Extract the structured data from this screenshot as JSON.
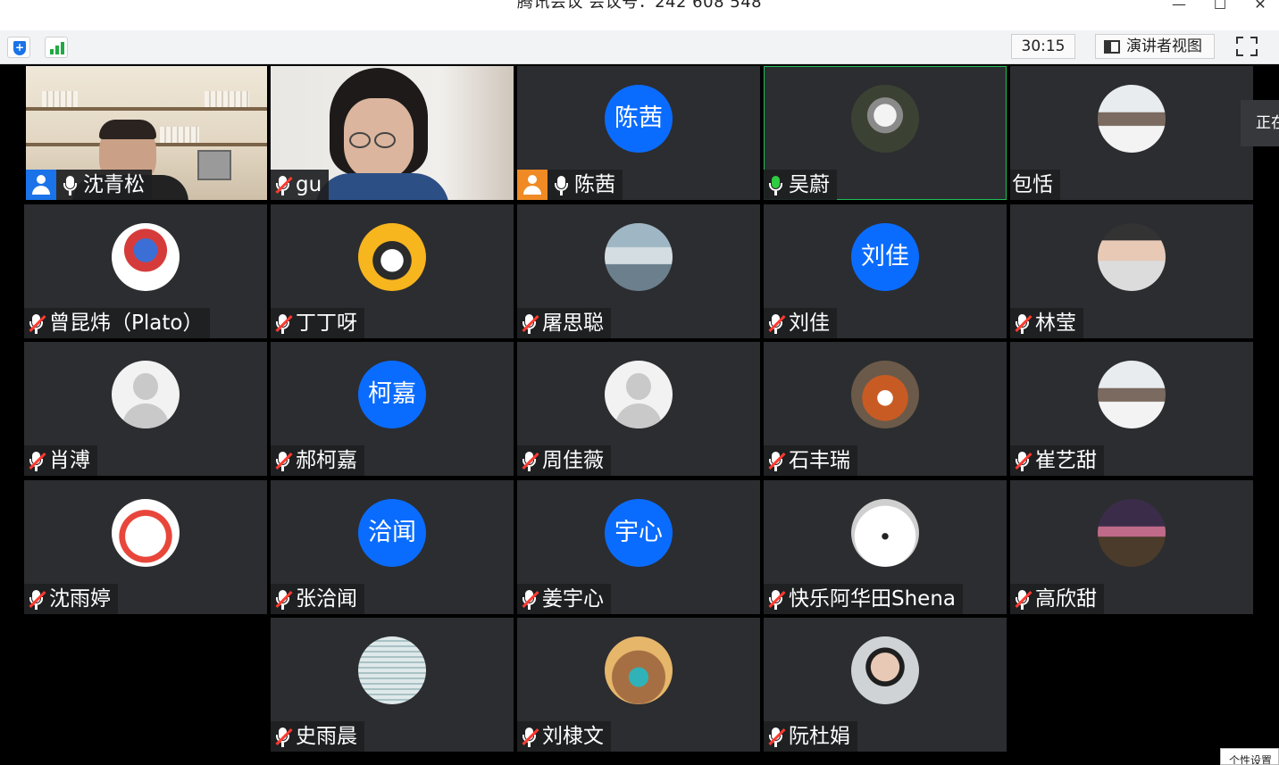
{
  "window": {
    "title": "腾讯会议 会议号：242 608 548",
    "min_glyph": "—",
    "max_glyph": "☐",
    "close_glyph": "✕"
  },
  "toolbar": {
    "security_icon": "shield-icon",
    "signal_icon": "network-signal-icon",
    "timer": "30:15",
    "presenter_view_label": "演讲者视图",
    "fullscreen_icon": "fullscreen-icon"
  },
  "side_tab": {
    "label": "正在"
  },
  "corner_popup": {
    "label": "个性设置"
  },
  "colors": {
    "avatar_blue": "#0a6cff",
    "speaking_green": "#1fbf58",
    "muted_red": "#ff3b30",
    "tile_bg": "#2c2d30"
  },
  "participants": [
    {
      "name": "沈青松",
      "video": true,
      "host_icon": "blue",
      "mic": "on"
    },
    {
      "name": "gu",
      "video": true,
      "mic": "muted"
    },
    {
      "name": "陈茜",
      "avatar_text": "陈茜",
      "host_icon": "orange",
      "mic": "on"
    },
    {
      "name": "吴蔚",
      "avatar_icon": "cat-photo",
      "mic": "speaking"
    },
    {
      "name": "包恬",
      "avatar_icon": "person-photo",
      "mic": "none"
    },
    {
      "name": "曾昆炜（Plato）",
      "avatar_icon": "hero-illustration",
      "mic": "muted"
    },
    {
      "name": "丁丁呀",
      "avatar_icon": "cartoon-girl",
      "mic": "muted"
    },
    {
      "name": "屠思聪",
      "avatar_icon": "cloud-photo",
      "mic": "muted"
    },
    {
      "name": "刘佳",
      "avatar_text": "刘佳",
      "mic": "muted"
    },
    {
      "name": "林莹",
      "avatar_icon": "masked-person-photo",
      "mic": "muted"
    },
    {
      "name": "肖溥",
      "avatar_icon": "default-avatar",
      "mic": "muted"
    },
    {
      "name": "郝柯嘉",
      "avatar_text": "柯嘉",
      "mic": "muted"
    },
    {
      "name": "周佳薇",
      "avatar_icon": "default-avatar",
      "mic": "muted"
    },
    {
      "name": "石丰瑞",
      "avatar_icon": "red-panda-photo",
      "mic": "muted"
    },
    {
      "name": "崔艺甜",
      "avatar_icon": "person-photo",
      "mic": "muted"
    },
    {
      "name": "沈雨婷",
      "avatar_icon": "cartoon-snowman",
      "mic": "muted"
    },
    {
      "name": "张洽闻",
      "avatar_text": "洽闻",
      "mic": "muted"
    },
    {
      "name": "姜宇心",
      "avatar_text": "宇心",
      "mic": "muted"
    },
    {
      "name": "快乐阿华田Shena",
      "avatar_icon": "samoyed-photo",
      "mic": "muted"
    },
    {
      "name": "高欣甜",
      "avatar_icon": "city-night-photo",
      "mic": "muted"
    },
    {
      "name": "史雨晨",
      "avatar_icon": "striped-seal-image",
      "mic": "muted"
    },
    {
      "name": "刘棣文",
      "avatar_icon": "cartoon-animal-mask",
      "mic": "muted"
    },
    {
      "name": "阮杜娟",
      "avatar_icon": "woman-glasses-photo",
      "mic": "muted"
    }
  ]
}
